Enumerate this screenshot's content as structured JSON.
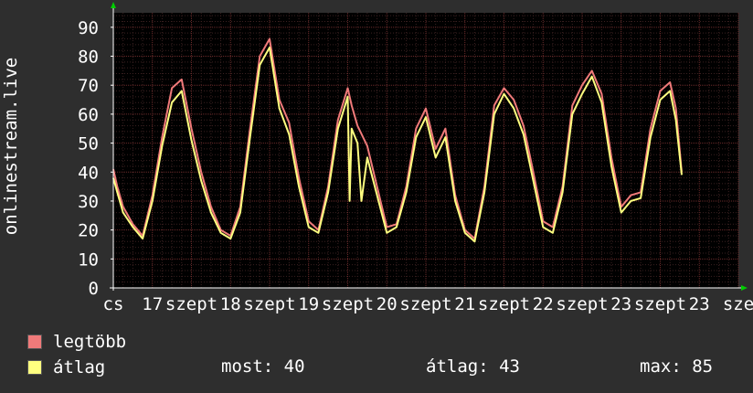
{
  "chart_data": {
    "type": "line",
    "ylabel": "onlinestream.live",
    "ylim": [
      0,
      95
    ],
    "yticks": [
      0,
      10,
      20,
      30,
      40,
      50,
      60,
      70,
      80,
      90
    ],
    "xlim": [
      0,
      16
    ],
    "xticks": [
      {
        "x": 0.0,
        "label": "cs"
      },
      {
        "x": 1.0,
        "label": "17"
      },
      {
        "x": 2.0,
        "label": "szept"
      },
      {
        "x": 3.0,
        "label": "18"
      },
      {
        "x": 4.0,
        "label": "szept"
      },
      {
        "x": 5.0,
        "label": "19"
      },
      {
        "x": 6.0,
        "label": "szept"
      },
      {
        "x": 7.0,
        "label": "20"
      },
      {
        "x": 8.0,
        "label": "szept"
      },
      {
        "x": 9.0,
        "label": "21"
      },
      {
        "x": 10.0,
        "label": "szept"
      },
      {
        "x": 11.0,
        "label": "22"
      },
      {
        "x": 12.0,
        "label": "szept"
      },
      {
        "x": 13.0,
        "label": "23"
      },
      {
        "x": 14.0,
        "label": "szept"
      },
      {
        "x": 15.0,
        "label": "23"
      },
      {
        "x": 16.0,
        "label": "sze"
      }
    ],
    "grid": true,
    "series": [
      {
        "name": "legtöbb",
        "color": "#f07a7a",
        "points": [
          [
            0.0,
            41
          ],
          [
            0.1,
            35
          ],
          [
            0.25,
            28
          ],
          [
            0.5,
            22
          ],
          [
            0.75,
            18
          ],
          [
            1.0,
            32
          ],
          [
            1.25,
            52
          ],
          [
            1.5,
            69
          ],
          [
            1.75,
            72
          ],
          [
            2.0,
            55
          ],
          [
            2.25,
            40
          ],
          [
            2.5,
            28
          ],
          [
            2.75,
            20
          ],
          [
            3.0,
            18
          ],
          [
            3.25,
            28
          ],
          [
            3.5,
            55
          ],
          [
            3.75,
            80
          ],
          [
            4.0,
            86
          ],
          [
            4.25,
            65
          ],
          [
            4.5,
            57
          ],
          [
            4.75,
            38
          ],
          [
            5.0,
            23
          ],
          [
            5.25,
            20
          ],
          [
            5.5,
            35
          ],
          [
            5.75,
            58
          ],
          [
            6.0,
            69
          ],
          [
            6.1,
            63
          ],
          [
            6.25,
            56
          ],
          [
            6.5,
            49
          ],
          [
            6.75,
            35
          ],
          [
            7.0,
            21
          ],
          [
            7.25,
            22
          ],
          [
            7.5,
            35
          ],
          [
            7.75,
            55
          ],
          [
            8.0,
            62
          ],
          [
            8.25,
            48
          ],
          [
            8.5,
            55
          ],
          [
            8.75,
            32
          ],
          [
            9.0,
            20
          ],
          [
            9.25,
            17
          ],
          [
            9.5,
            35
          ],
          [
            9.75,
            63
          ],
          [
            10.0,
            69
          ],
          [
            10.25,
            65
          ],
          [
            10.5,
            56
          ],
          [
            10.75,
            40
          ],
          [
            11.0,
            23
          ],
          [
            11.25,
            21
          ],
          [
            11.5,
            35
          ],
          [
            11.75,
            63
          ],
          [
            12.0,
            70
          ],
          [
            12.25,
            75
          ],
          [
            12.5,
            67
          ],
          [
            12.75,
            45
          ],
          [
            13.0,
            28
          ],
          [
            13.25,
            32
          ],
          [
            13.5,
            33
          ],
          [
            13.75,
            55
          ],
          [
            14.0,
            68
          ],
          [
            14.25,
            71
          ],
          [
            14.4,
            62
          ],
          [
            14.55,
            40
          ]
        ]
      },
      {
        "name": "átlag",
        "color": "#ffff80",
        "points": [
          [
            0.0,
            38
          ],
          [
            0.1,
            33
          ],
          [
            0.25,
            26
          ],
          [
            0.5,
            21
          ],
          [
            0.75,
            17
          ],
          [
            1.0,
            30
          ],
          [
            1.25,
            49
          ],
          [
            1.5,
            64
          ],
          [
            1.75,
            68
          ],
          [
            2.0,
            51
          ],
          [
            2.25,
            37
          ],
          [
            2.5,
            26
          ],
          [
            2.75,
            19
          ],
          [
            3.0,
            17
          ],
          [
            3.25,
            26
          ],
          [
            3.5,
            52
          ],
          [
            3.75,
            77
          ],
          [
            4.0,
            83
          ],
          [
            4.25,
            62
          ],
          [
            4.5,
            53
          ],
          [
            4.75,
            35
          ],
          [
            5.0,
            21
          ],
          [
            5.25,
            19
          ],
          [
            5.5,
            33
          ],
          [
            5.75,
            55
          ],
          [
            6.0,
            66
          ],
          [
            6.05,
            30
          ],
          [
            6.1,
            55
          ],
          [
            6.25,
            50
          ],
          [
            6.35,
            30
          ],
          [
            6.5,
            45
          ],
          [
            6.75,
            32
          ],
          [
            7.0,
            19
          ],
          [
            7.25,
            21
          ],
          [
            7.5,
            33
          ],
          [
            7.75,
            52
          ],
          [
            8.0,
            59
          ],
          [
            8.25,
            45
          ],
          [
            8.5,
            52
          ],
          [
            8.75,
            30
          ],
          [
            9.0,
            19
          ],
          [
            9.25,
            16
          ],
          [
            9.5,
            33
          ],
          [
            9.75,
            60
          ],
          [
            10.0,
            67
          ],
          [
            10.25,
            62
          ],
          [
            10.5,
            53
          ],
          [
            10.75,
            37
          ],
          [
            11.0,
            21
          ],
          [
            11.25,
            19
          ],
          [
            11.5,
            33
          ],
          [
            11.75,
            60
          ],
          [
            12.0,
            67
          ],
          [
            12.25,
            73
          ],
          [
            12.5,
            64
          ],
          [
            12.75,
            42
          ],
          [
            13.0,
            26
          ],
          [
            13.25,
            30
          ],
          [
            13.5,
            31
          ],
          [
            13.75,
            52
          ],
          [
            14.0,
            65
          ],
          [
            14.25,
            68
          ],
          [
            14.4,
            58
          ],
          [
            14.55,
            39
          ]
        ]
      }
    ]
  },
  "legend": {
    "items": [
      {
        "label": "legtöbb",
        "color": "#f07a7a"
      },
      {
        "label": "átlag",
        "color": "#ffff80"
      }
    ],
    "stats": {
      "most": "most: 40",
      "atlag": "átlag: 43",
      "max": "max: 85"
    }
  },
  "colors": {
    "background": "#2e2e2e",
    "plot_background": "#000000",
    "grid_minor": "#3a2020",
    "grid_major": "#6a2a2a",
    "axis": "#ffffff",
    "arrow": "#00cc00"
  }
}
